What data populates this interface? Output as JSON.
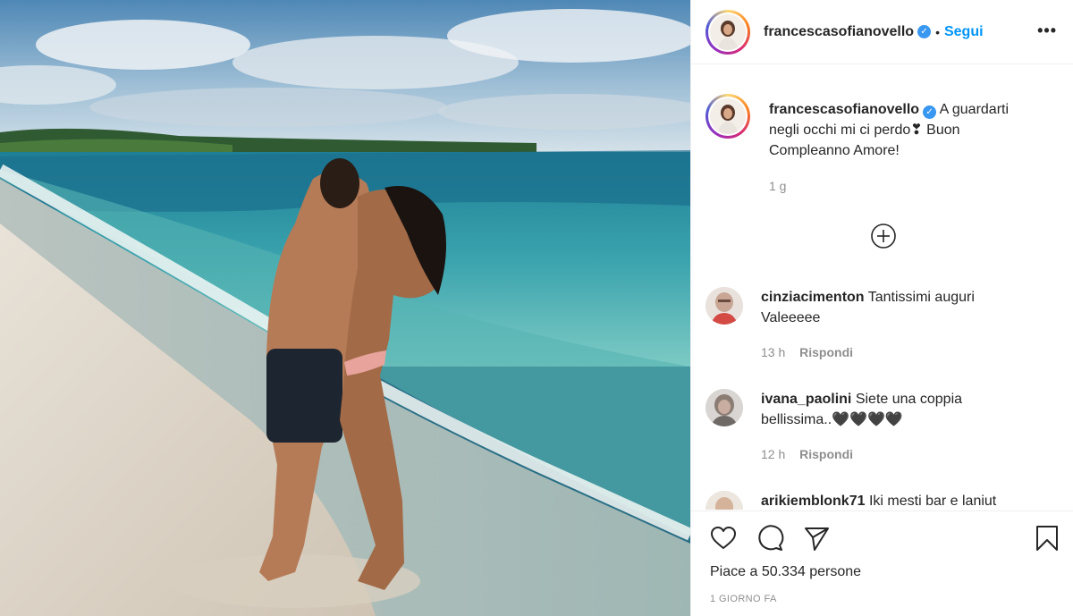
{
  "post": {
    "username": "francescasofianovello",
    "verified": true,
    "separator": "•",
    "follow_label": "Segui",
    "more_label": "•••",
    "caption": "A guardarti negli occhi mi ci perdo❣ Buon Compleanno Amore!",
    "caption_time": "1 g"
  },
  "comments": [
    {
      "username": "cinziacimenton",
      "text": "Tantissimi auguri Valeeeee",
      "time": "13 h",
      "reply_label": "Rispondi"
    },
    {
      "username": "ivana_paolini",
      "text": "Siete una coppia bellissima..🖤🖤🖤🖤",
      "time": "12 h",
      "reply_label": "Rispondi"
    },
    {
      "username": "arikiemblonk71",
      "text": "Iki mesti bar e laniut"
    }
  ],
  "footer": {
    "likes": "Piace a 50.334 persone",
    "date": "1 GIORNO FA"
  },
  "icons": {
    "like": "heart-icon",
    "comment": "comment-icon",
    "share": "send-icon",
    "save": "bookmark-icon",
    "load_more": "plus-circle-icon"
  },
  "colors": {
    "accent": "#0095f6",
    "verified": "#3897f0",
    "muted": "#8e8e8e"
  }
}
